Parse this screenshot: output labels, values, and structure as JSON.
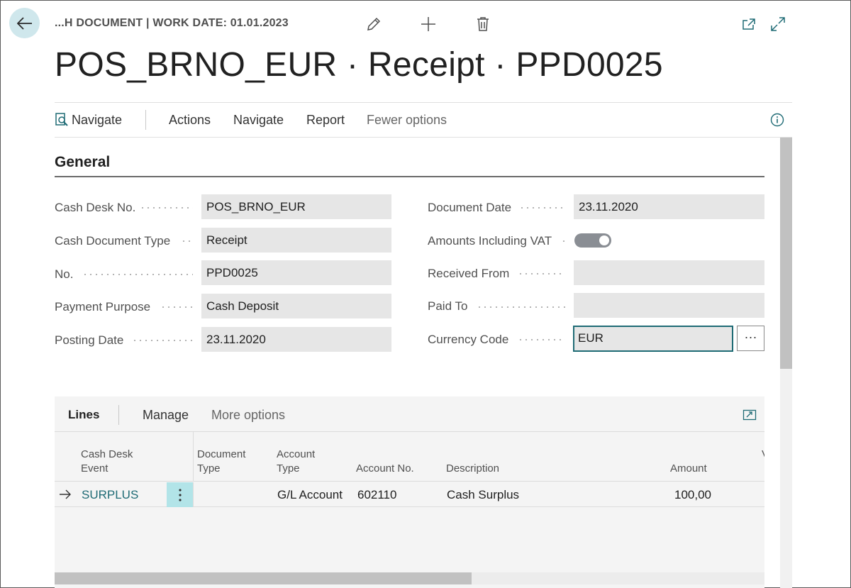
{
  "header": {
    "breadcrumb": "...H DOCUMENT | WORK DATE: 01.01.2023",
    "title": "POS_BRNO_EUR · Receipt · PPD0025"
  },
  "actionbar": {
    "navigate_icon_label": "Navigate",
    "actions": "Actions",
    "navigate": "Navigate",
    "report": "Report",
    "fewer_options": "Fewer options"
  },
  "general": {
    "title": "General",
    "cash_desk_no": {
      "label": "Cash Desk No.",
      "value": "POS_BRNO_EUR"
    },
    "cash_document_type": {
      "label": "Cash Document Type",
      "value": "Receipt"
    },
    "no": {
      "label": "No.",
      "value": "PPD0025"
    },
    "payment_purpose": {
      "label": "Payment Purpose",
      "value": "Cash Deposit"
    },
    "posting_date": {
      "label": "Posting Date",
      "value": "23.11.2020"
    },
    "document_date": {
      "label": "Document Date",
      "value": "23.11.2020"
    },
    "amounts_including_vat": {
      "label": "Amounts Including VAT",
      "value": true
    },
    "received_from": {
      "label": "Received From",
      "value": ""
    },
    "paid_to": {
      "label": "Paid To",
      "value": ""
    },
    "currency_code": {
      "label": "Currency Code",
      "value": "EUR"
    },
    "ellipsis": "···"
  },
  "lines": {
    "tab_lines": "Lines",
    "manage": "Manage",
    "more_options": "More options",
    "columns": {
      "cash_desk_event_1": "Cash Desk",
      "cash_desk_event_2": "Event",
      "document_type_1": "Document",
      "document_type_2": "Type",
      "account_type_1": "Account",
      "account_type_2": "Type",
      "account_no": "Account No.",
      "description": "Description",
      "amount": "Amount",
      "truncated": "V"
    },
    "rows": [
      {
        "cash_desk_event": "SURPLUS",
        "document_type": "",
        "account_type": "G/L Account",
        "account_no": "602110",
        "description": "Cash Surplus",
        "amount": "100,00"
      }
    ]
  },
  "colors": {
    "accent": "#1f6b75",
    "back_button_bg": "#cfe7ec",
    "row_menu_bg": "#b2e4e8"
  },
  "icons": {
    "back": "arrow-left-icon",
    "edit": "pencil-icon",
    "add": "plus-icon",
    "delete": "trash-icon",
    "open_new": "open-in-new-window-icon",
    "expand": "expand-icon",
    "navigate": "navigate-search-icon",
    "info": "info-icon",
    "row_arrow": "arrow-right-icon",
    "row_menu": "vertical-dots-icon",
    "lines_expand": "lines-expand-icon"
  }
}
